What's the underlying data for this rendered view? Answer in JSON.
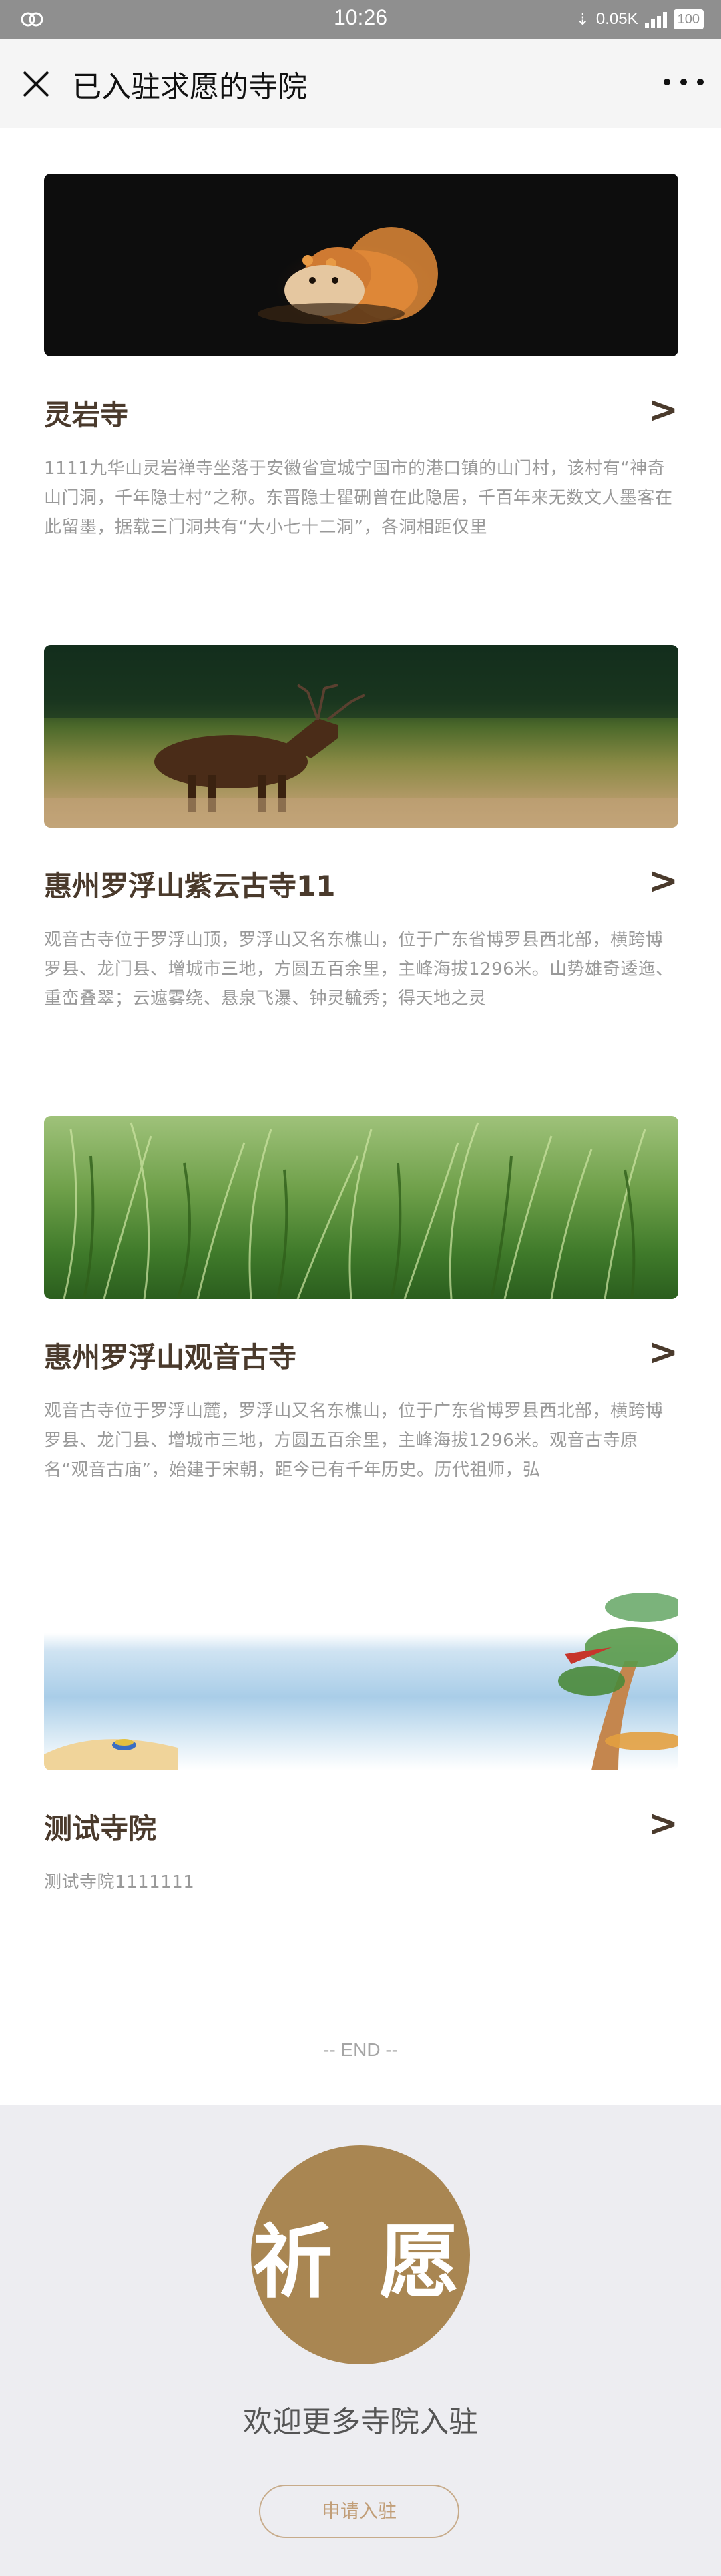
{
  "status_bar": {
    "time": "10:26",
    "network_speed": "0.05K",
    "battery": "100",
    "icons": [
      "link-icon",
      "download-speed-icon",
      "signal-icon",
      "battery-icon"
    ]
  },
  "nav": {
    "title": "已入驻求愿的寺院",
    "close_icon": "close-icon",
    "more_icon": "more-icon"
  },
  "temples": [
    {
      "name": "灵岩寺",
      "description": "1111九华山灵岩禅寺坐落于安徽省宣城宁国市的港口镇的山门村，该村有“神奇山门洞，千年隐士村”之称。东晋隐士瞿硎曾在此隐居，千百年来无数文人墨客在此留墨，据载三门洞共有“大小七十二洞”，各洞相距仅里",
      "image": "squirrel-photo"
    },
    {
      "name": "惠州罗浮山紫云古寺11",
      "description": "观音古寺位于罗浮山顶，罗浮山又名东樵山，位于广东省博罗县西北部，横跨博罗县、龙门县、增城市三地，方圆五百余里，主峰海拔1296米。山势雄奇逶迤、重峦叠翠；云遮雾绕、悬泉飞瀑、钟灵毓秀；得天地之灵",
      "image": "deer-photo"
    },
    {
      "name": "惠州罗浮山观音古寺",
      "description": "观音古寺位于罗浮山麓，罗浮山又名东樵山，位于广东省博罗县西北部，横跨博罗县、龙门县、增城市三地，方圆五百余里，主峰海拔1296米。观音古寺原名“观音古庙”，始建于宋朝，距今已有千年历史。历代祖师，弘",
      "image": "grass-photo"
    },
    {
      "name": "测试寺院",
      "description": "测试寺院1111111",
      "image": "watercolor-beach-painting"
    }
  ],
  "arrow_glyph": ">",
  "end_text": "-- END --",
  "footer": {
    "badge_text": "祈 愿",
    "welcome": "欢迎更多寺院入驻",
    "apply_label": "申请入驻"
  },
  "colors": {
    "accent": "#a98652",
    "title_brown": "#4a3a2c",
    "status_bar": "#8f8f8f",
    "footer_bg": "#ededf1"
  }
}
